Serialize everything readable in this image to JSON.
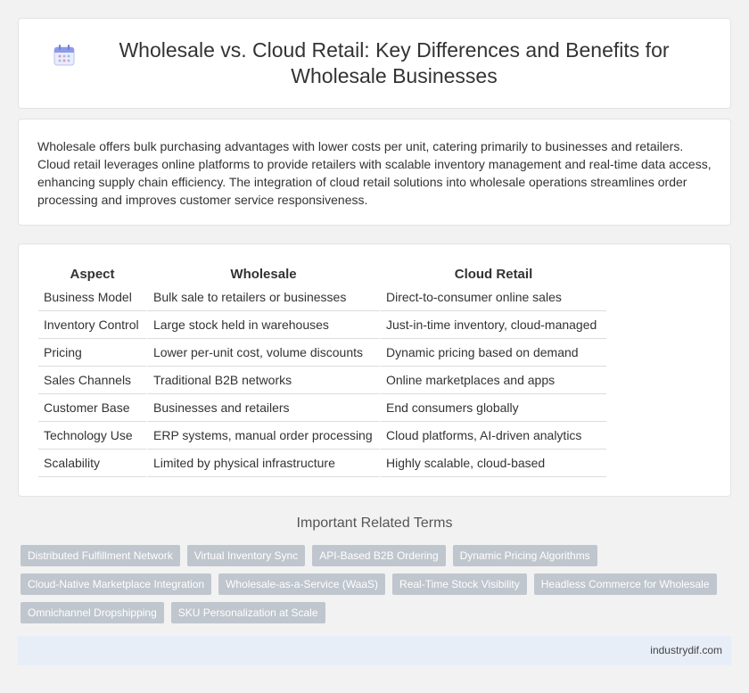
{
  "header": {
    "title": "Wholesale vs. Cloud Retail: Key Differences and Benefits for Wholesale Businesses",
    "icon": "calendar-icon"
  },
  "intro": {
    "text": "Wholesale offers bulk purchasing advantages with lower costs per unit, catering primarily to businesses and retailers. Cloud retail leverages online platforms to provide retailers with scalable inventory management and real-time data access, enhancing supply chain efficiency. The integration of cloud retail solutions into wholesale operations streamlines order processing and improves customer service responsiveness."
  },
  "table": {
    "headers": [
      "Aspect",
      "Wholesale",
      "Cloud Retail"
    ],
    "rows": [
      [
        "Business Model",
        "Bulk sale to retailers or businesses",
        "Direct-to-consumer online sales"
      ],
      [
        "Inventory Control",
        "Large stock held in warehouses",
        "Just-in-time inventory, cloud-managed"
      ],
      [
        "Pricing",
        "Lower per-unit cost, volume discounts",
        "Dynamic pricing based on demand"
      ],
      [
        "Sales Channels",
        "Traditional B2B networks",
        "Online marketplaces and apps"
      ],
      [
        "Customer Base",
        "Businesses and retailers",
        "End consumers globally"
      ],
      [
        "Technology Use",
        "ERP systems, manual order processing",
        "Cloud platforms, AI-driven analytics"
      ],
      [
        "Scalability",
        "Limited by physical infrastructure",
        "Highly scalable, cloud-based"
      ]
    ]
  },
  "related": {
    "heading": "Important Related Terms",
    "tags": [
      "Distributed Fulfillment Network",
      "Virtual Inventory Sync",
      "API-Based B2B Ordering",
      "Dynamic Pricing Algorithms",
      "Cloud-Native Marketplace Integration",
      "Wholesale-as-a-Service (WaaS)",
      "Real-Time Stock Visibility",
      "Headless Commerce for Wholesale",
      "Omnichannel Dropshipping",
      "SKU Personalization at Scale"
    ]
  },
  "footer": {
    "site": "industrydif.com"
  },
  "colors": {
    "tag_bg": "#c0c6ce",
    "footer_bg": "#e8eef7",
    "icon_accent": "#7b8ce0"
  }
}
